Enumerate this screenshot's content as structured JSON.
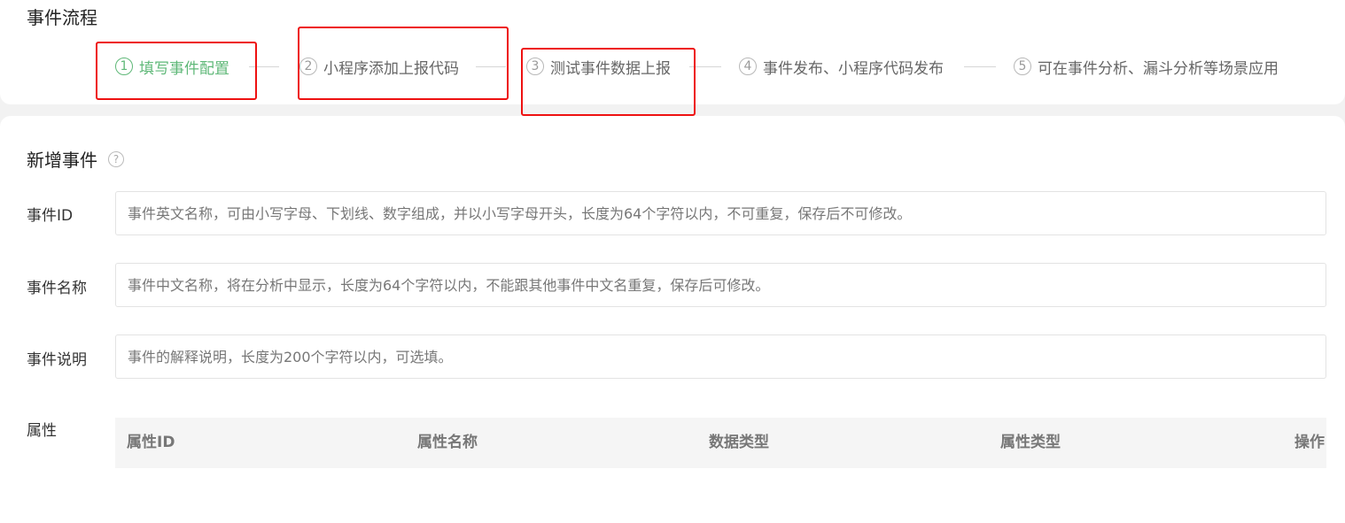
{
  "flow": {
    "title": "事件流程",
    "steps": [
      {
        "num": "1",
        "label": "填写事件配置",
        "active": true
      },
      {
        "num": "2",
        "label": "小程序添加上报代码",
        "active": false
      },
      {
        "num": "3",
        "label": "测试事件数据上报",
        "active": false
      },
      {
        "num": "4",
        "label": "事件发布、小程序代码发布",
        "active": false
      },
      {
        "num": "5",
        "label": "可在事件分析、漏斗分析等场景应用",
        "active": false
      }
    ]
  },
  "form": {
    "title": "新增事件",
    "help_glyph": "?",
    "fields": {
      "event_id": {
        "label": "事件ID",
        "placeholder": "事件英文名称，可由小写字母、下划线、数字组成，并以小写字母开头，长度为64个字符以内，不可重复，保存后不可修改。"
      },
      "event_name": {
        "label": "事件名称",
        "placeholder": "事件中文名称，将在分析中显示，长度为64个字符以内，不能跟其他事件中文名重复，保存后可修改。"
      },
      "event_desc": {
        "label": "事件说明",
        "placeholder": "事件的解释说明，长度为200个字符以内，可选填。"
      }
    },
    "attributes": {
      "label": "属性",
      "columns": [
        "属性ID",
        "属性名称",
        "数据类型",
        "属性类型",
        "操作"
      ]
    }
  },
  "colors": {
    "active_step": "#5fb878",
    "highlight": "#ee1111"
  }
}
